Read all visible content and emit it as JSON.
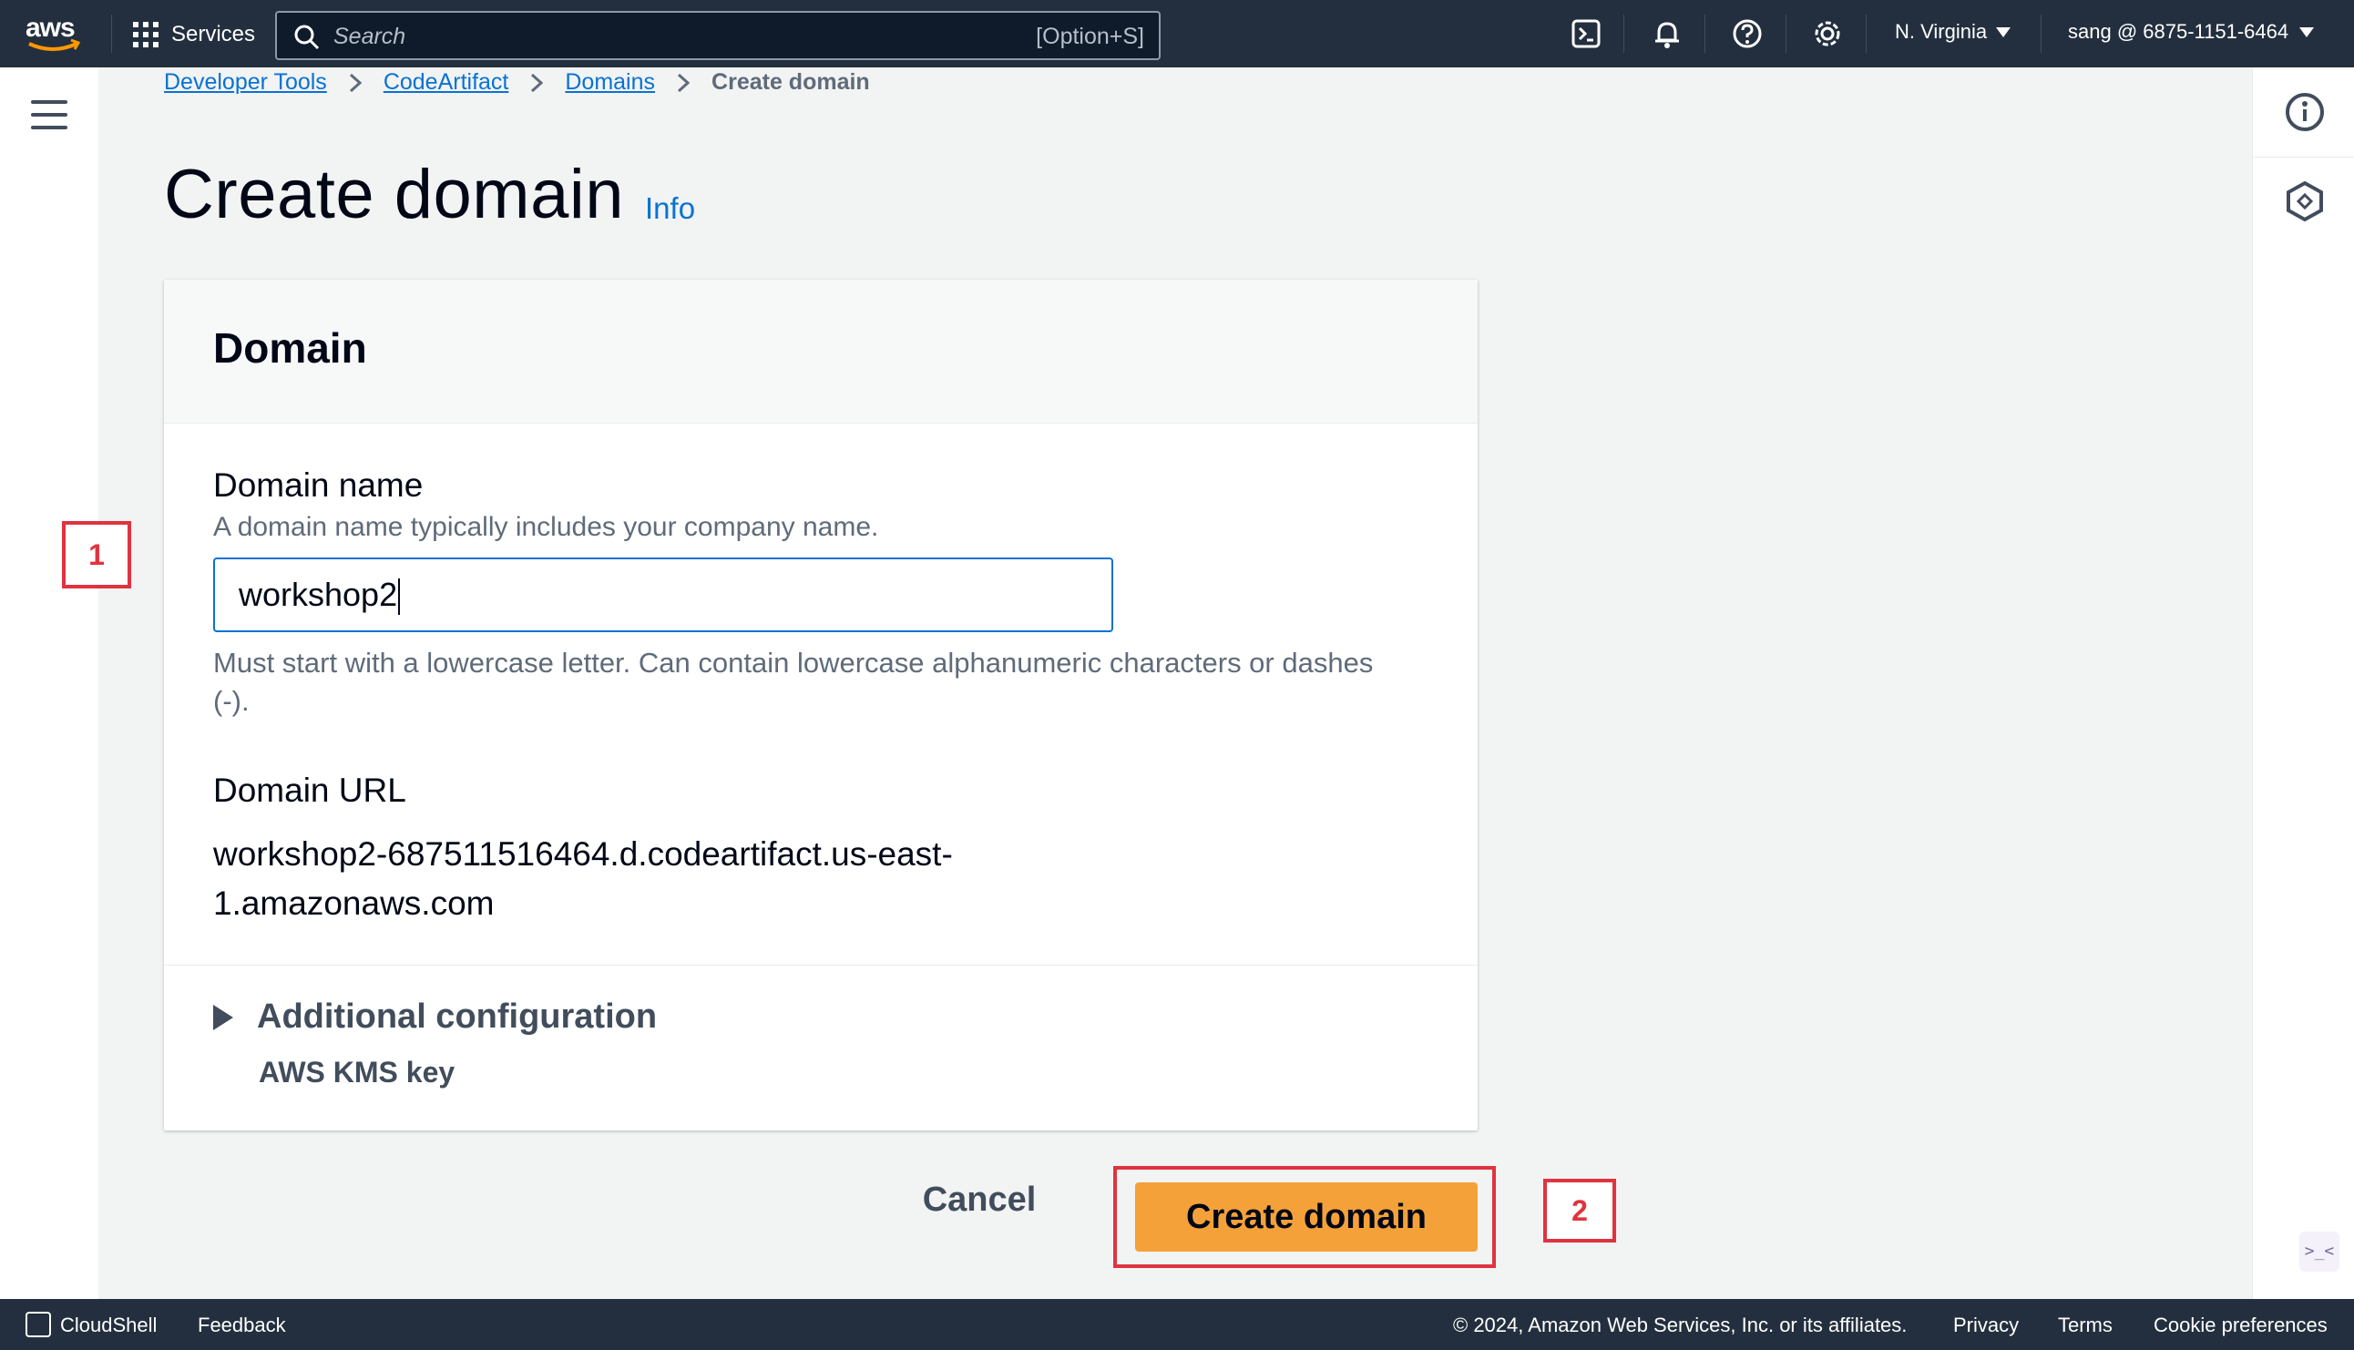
{
  "topnav": {
    "logo": "aws",
    "services_label": "Services",
    "search_placeholder": "Search",
    "search_shortcut": "[Option+S]",
    "icons": [
      "cloudshell-icon",
      "bell-icon",
      "help-icon",
      "settings-icon"
    ],
    "region": "N. Virginia",
    "account": "sang @ 6875-1151-6464"
  },
  "breadcrumb": {
    "items": [
      "Developer Tools",
      "CodeArtifact",
      "Domains"
    ],
    "current": "Create domain"
  },
  "page": {
    "title": "Create domain",
    "info": "Info"
  },
  "panel": {
    "heading": "Domain",
    "domain_name_label": "Domain name",
    "domain_name_desc": "A domain name typically includes your company name.",
    "domain_name_value": "workshop2",
    "constraint": "Must start with a lowercase letter. Can contain lowercase alphanumeric characters or dashes (-).",
    "url_label": "Domain URL",
    "url_value": "workshop2-687511516464.d.codeartifact.us-east-1.amazonaws.com",
    "additional_label": "Additional configuration",
    "additional_sub": "AWS KMS key"
  },
  "actions": {
    "cancel": "Cancel",
    "create": "Create domain"
  },
  "annotations": {
    "marker1": "1",
    "marker2": "2",
    "color": "#e0333f"
  },
  "footer": {
    "cloudshell": "CloudShell",
    "feedback": "Feedback",
    "copyright": "© 2024, Amazon Web Services, Inc. or its affiliates.",
    "privacy": "Privacy",
    "terms": "Terms",
    "cookies": "Cookie preferences"
  },
  "colors": {
    "nav_bg": "#232f3e",
    "primary_button": "#f5a13a",
    "link": "#0972d3"
  }
}
